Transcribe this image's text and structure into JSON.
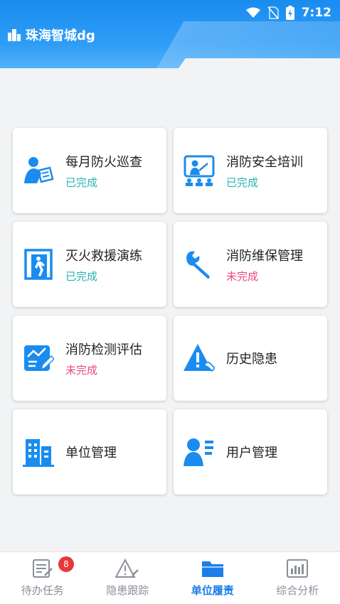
{
  "status_bar": {
    "time": "7:12"
  },
  "header": {
    "title": "珠海智城dg"
  },
  "colors": {
    "accent": "#1a8cf0",
    "done": "#2bb3b0",
    "todo": "#e94b7a"
  },
  "cards": [
    {
      "label": "每月防火巡查",
      "status": "已完成",
      "state": "done",
      "icon": "inspector-icon"
    },
    {
      "label": "消防安全培训",
      "status": "已完成",
      "state": "done",
      "icon": "training-icon"
    },
    {
      "label": "灭火救援演练",
      "status": "已完成",
      "state": "done",
      "icon": "exit-drill-icon"
    },
    {
      "label": "消防维保管理",
      "status": "未完成",
      "state": "todo",
      "icon": "wrench-icon"
    },
    {
      "label": "消防检测评估",
      "status": "未完成",
      "state": "todo",
      "icon": "assessment-icon"
    },
    {
      "label": "历史隐患",
      "status": "",
      "state": "",
      "icon": "hazard-icon"
    },
    {
      "label": "单位管理",
      "status": "",
      "state": "",
      "icon": "building-icon"
    },
    {
      "label": "用户管理",
      "status": "",
      "state": "",
      "icon": "user-list-icon"
    }
  ],
  "bottom_nav": [
    {
      "label": "待办任务",
      "icon": "todo-icon",
      "badge": "8",
      "active": false
    },
    {
      "label": "隐患跟踪",
      "icon": "hazard-track-icon",
      "active": false
    },
    {
      "label": "单位履责",
      "icon": "folder-icon",
      "active": true
    },
    {
      "label": "综合分析",
      "icon": "analytics-icon",
      "active": false
    }
  ]
}
